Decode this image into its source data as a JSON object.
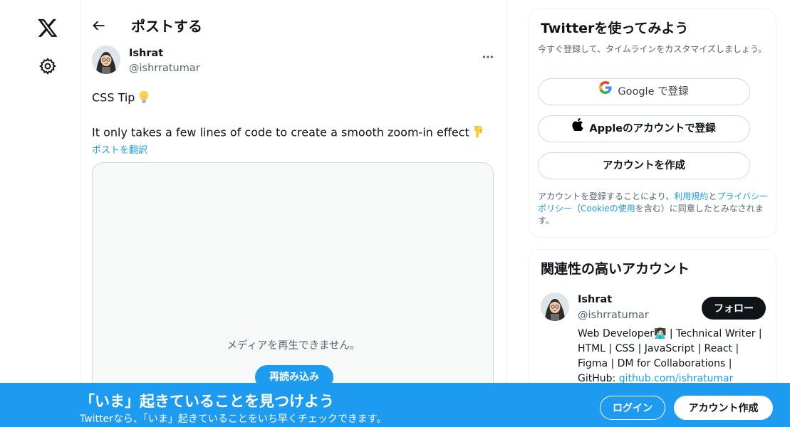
{
  "nav": {
    "logo_icon": "x-logo-icon",
    "settings_icon": "gear-icon"
  },
  "header": {
    "back_icon": "back-arrow-icon",
    "title": "ポストする"
  },
  "post": {
    "author_name": "Ishrat",
    "author_handle": "@ishrratumar",
    "more_icon": "more-dots-icon",
    "text_line1": "CSS Tip",
    "text_line1_emoji": "lightbulb-emoji",
    "text_line2": "It only takes a few lines of code to create a smooth zoom-in effect",
    "text_line2_emoji": "pointing-down-emoji",
    "translate_link": "ポストを翻訳",
    "media": {
      "message": "メディアを再生できません。",
      "reload_label": "再読み込み"
    }
  },
  "signup_card": {
    "title": "Twitterを使ってみよう",
    "subtitle": "今すぐ登録して、タイムラインをカスタマイズしましょう。",
    "google_label": "Google で登録",
    "apple_label": "Appleのアカウントで登録",
    "create_label": "アカウントを作成",
    "legal_prefix": "アカウントを登録することにより、",
    "terms_link": "利用規約",
    "and_text": "と",
    "privacy_link": "プライバシーポリシー",
    "paren_open": "（",
    "cookie_link": "Cookieの使用",
    "legal_suffix": "を含む）に同意したとみなされます。"
  },
  "related": {
    "title": "関連性の高いアカウント",
    "name": "Ishrat",
    "handle": "@ishrratumar",
    "follow_label": "フォロー",
    "bio_text": "Web Developer👩🏻‍💻 | Technical Writer | HTML | CSS | JavaScript | React | Figma | DM for Collaborations | GitHub: ",
    "bio_link": "github.com/ishratumar"
  },
  "banner": {
    "title": "「いま」起きていることを見つけよう",
    "subtitle": "Twitterなら、「いま」起きていることをいち早くチェックできます。",
    "login_label": "ログイン",
    "signup_label": "アカウント作成"
  },
  "colors": {
    "accent": "#1d9bf0",
    "text": "#0f1419",
    "muted": "#536471",
    "border": "#cfd9de"
  }
}
